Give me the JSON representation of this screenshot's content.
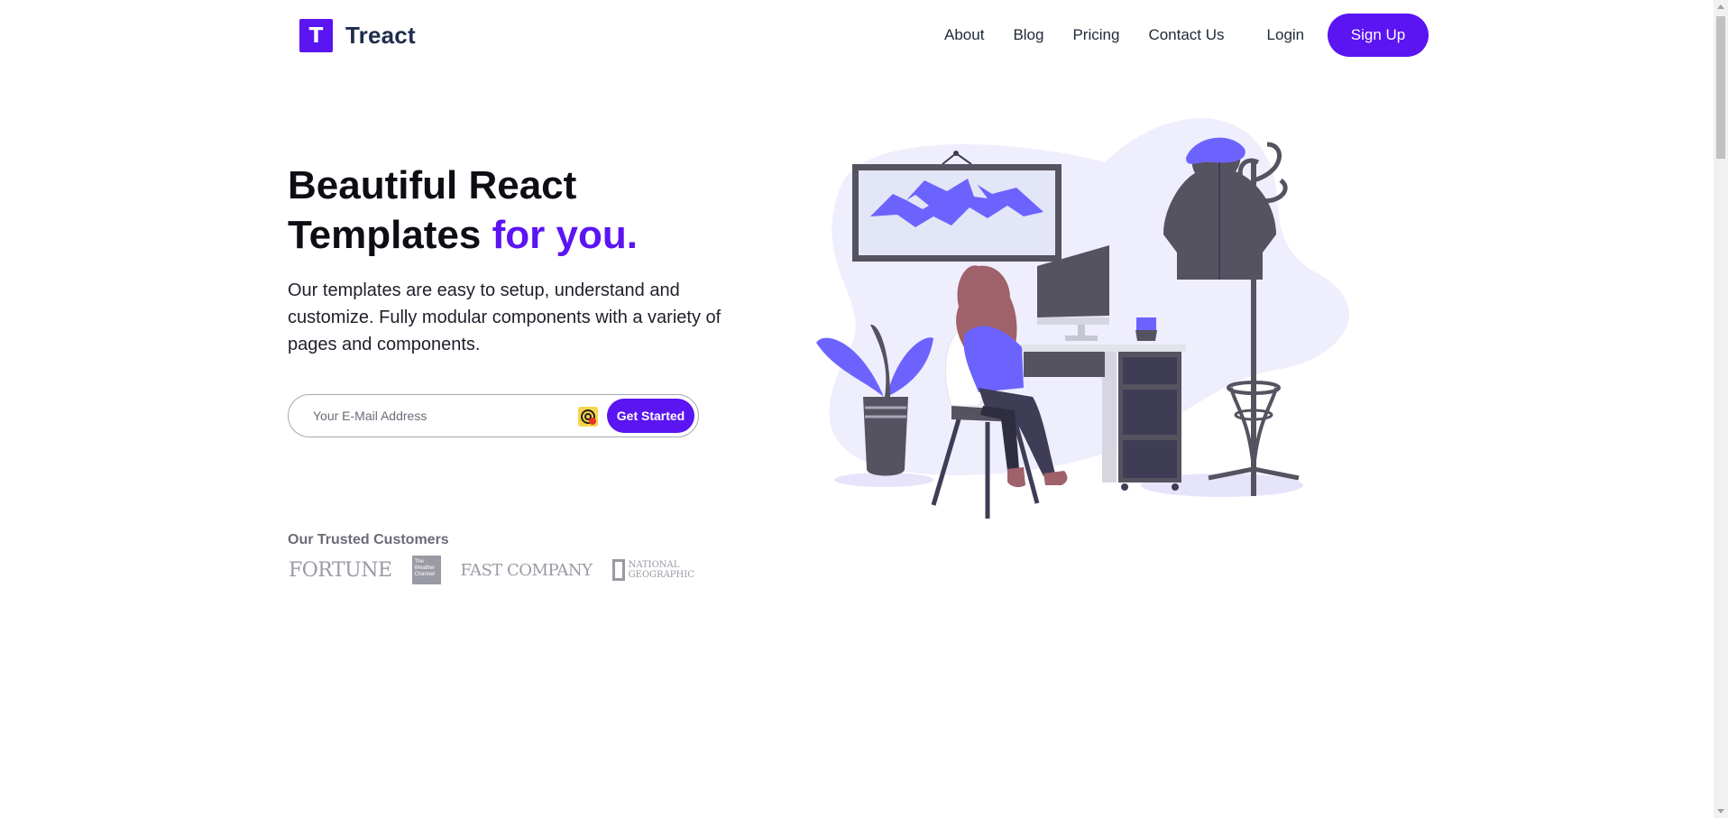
{
  "brand": {
    "logo_letter": "T",
    "name": "Treact",
    "accent_color": "#5b14f2"
  },
  "nav": {
    "items": [
      "About",
      "Blog",
      "Pricing",
      "Contact Us"
    ],
    "login_label": "Login",
    "signup_label": "Sign Up"
  },
  "hero": {
    "title_line1": "Beautiful React",
    "title_line2": "Templates",
    "title_accent": "for you.",
    "description": "Our templates are easy to setup, understand and customize. Fully modular components with a variety of pages and components.",
    "email_placeholder": "Your E-Mail Address",
    "cta_label": "Get Started"
  },
  "customers": {
    "title": "Our Trusted Customers",
    "logos": [
      "FORTUNE",
      "The Weather Channel",
      "FAST COMPANY",
      "NATIONAL GEOGRAPHIC"
    ]
  },
  "icons": {
    "extension": "password-manager-icon",
    "scroll_up": "scroll-up-arrow-icon",
    "scroll_down": "scroll-down-arrow-icon"
  }
}
